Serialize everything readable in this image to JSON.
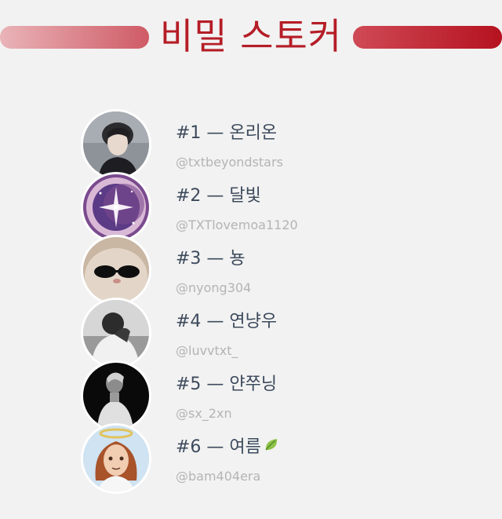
{
  "header": {
    "title": "비밀 스토커"
  },
  "members": [
    {
      "rank_name": "#1 — 온리온",
      "handle": "@txtbeyondstars",
      "avatar_icon": "person-portrait-icon"
    },
    {
      "rank_name": "#2 — 달빛",
      "handle": "@TXTlovemoa1120",
      "avatar_icon": "moon-star-icon"
    },
    {
      "rank_name": "#3 — 뇽",
      "handle": "@nyong304",
      "avatar_icon": "cat-sunglasses-icon"
    },
    {
      "rank_name": "#4 — 연냥우",
      "handle": "@luvvtxt_",
      "avatar_icon": "person-bw-icon"
    },
    {
      "rank_name": "#5 — 얀쭈닝",
      "handle": "@sx_2xn",
      "avatar_icon": "person-dark-icon"
    },
    {
      "rank_name": "#6 — 여름",
      "handle": "@bam404era",
      "avatar_icon": "angel-character-icon",
      "trailing_icon": "leaf-icon"
    }
  ],
  "colors": {
    "title": "#b51d27",
    "background": "#f2f2f2",
    "name_text": "#3d4a5c",
    "handle_text": "#b4b4b4",
    "bar_left": "#e9b4b8",
    "bar_right": "#b5121f"
  }
}
